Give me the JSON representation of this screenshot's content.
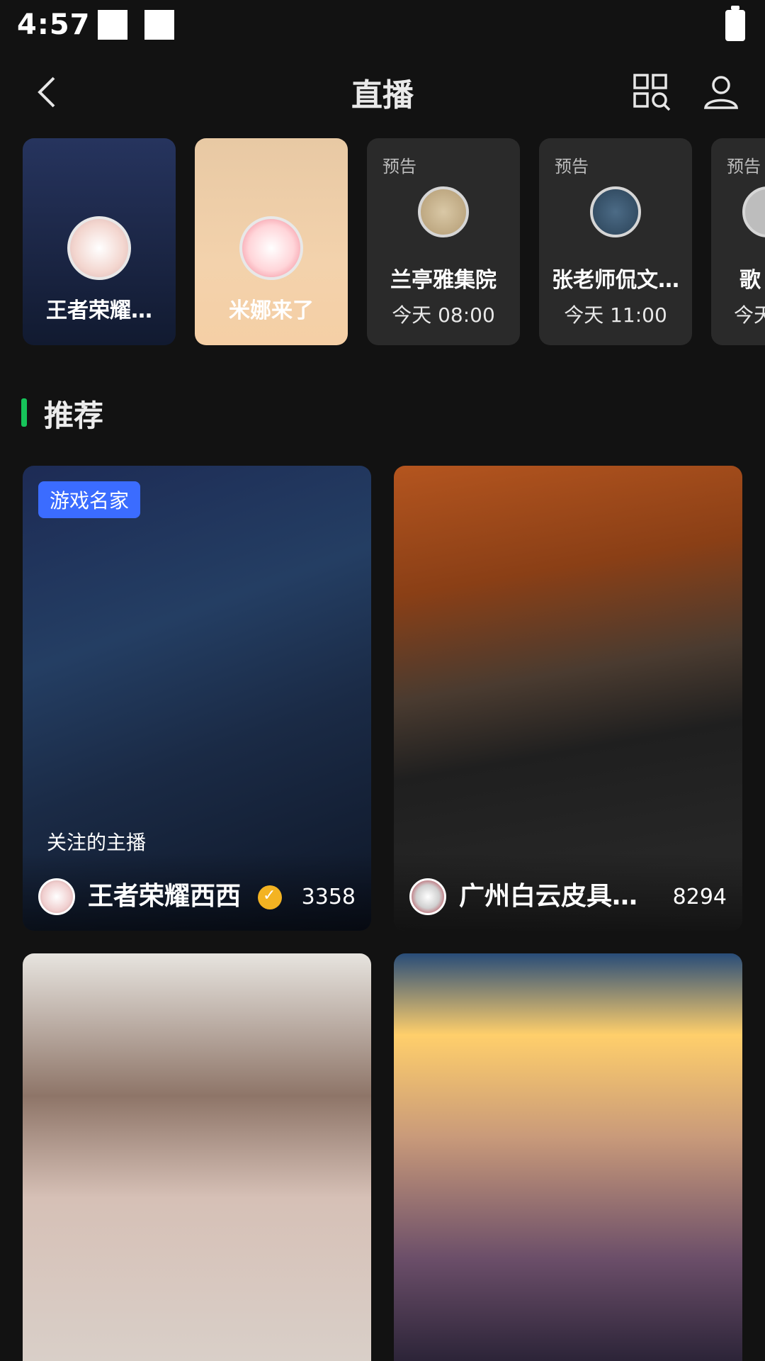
{
  "status_bar": {
    "time": "4:57"
  },
  "nav": {
    "title": "直播",
    "back_icon": "chevron-left-icon",
    "scan_icon": "grid-search-icon",
    "profile_icon": "user-icon"
  },
  "top_cards": [
    {
      "type": "live",
      "name": "王者荣耀…"
    },
    {
      "type": "live",
      "name": "米娜来了"
    },
    {
      "type": "preview",
      "label": "预告",
      "name": "兰亭雅集院",
      "time": "今天 08:00"
    },
    {
      "type": "preview",
      "label": "预告",
      "name": "张老师侃文…",
      "time": "今天 11:00"
    },
    {
      "type": "preview",
      "label": "预告",
      "name": "歌",
      "time": "今天"
    }
  ],
  "section": {
    "title": "推荐"
  },
  "feed": [
    {
      "badge": "游戏名家",
      "follow_label": "关注的主播",
      "name": "王者荣耀西西",
      "viewers": "3358",
      "verified": true
    },
    {
      "name": "广州白云皮具…",
      "viewers": "8294"
    },
    {
      "name": ""
    },
    {
      "name": ""
    }
  ],
  "colors": {
    "accent_green": "#16c45a",
    "badge_blue": "#3b6cff",
    "verified_gold": "#f3b322",
    "background": "#121212"
  }
}
